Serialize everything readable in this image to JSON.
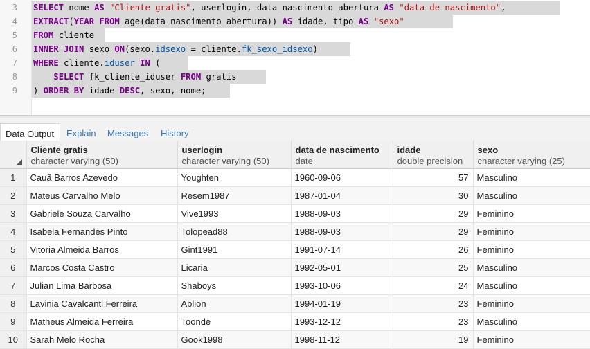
{
  "editor": {
    "line_numbers": [
      "3",
      "4",
      "5",
      "6",
      "7",
      "8",
      "9"
    ]
  },
  "tabs": [
    {
      "label": "Data Output"
    },
    {
      "label": "Explain"
    },
    {
      "label": "Messages"
    },
    {
      "label": "History"
    }
  ],
  "grid": {
    "columns": [
      {
        "name": "Cliente gratis",
        "type": "character varying (50)"
      },
      {
        "name": "userlogin",
        "type": "character varying (50)"
      },
      {
        "name": "data de nascimento",
        "type": "date"
      },
      {
        "name": "idade",
        "type": "double precision"
      },
      {
        "name": "sexo",
        "type": "character varying (25)"
      }
    ],
    "rows": [
      {
        "n": "1",
        "nome": "Cauã Barros Azevedo",
        "login": "Youghten",
        "data": "1960-09-06",
        "idade": "57",
        "sexo": "Masculino"
      },
      {
        "n": "2",
        "nome": "Mateus Carvalho Melo",
        "login": "Resem1987",
        "data": "1987-01-04",
        "idade": "30",
        "sexo": "Masculino"
      },
      {
        "n": "3",
        "nome": "Gabriele Souza Carvalho",
        "login": "Vive1993",
        "data": "1988-09-03",
        "idade": "29",
        "sexo": "Feminino"
      },
      {
        "n": "4",
        "nome": "Isabela Fernandes Pinto",
        "login": "Tolopead88",
        "data": "1988-09-03",
        "idade": "29",
        "sexo": "Feminino"
      },
      {
        "n": "5",
        "nome": "Vitoria Almeida Barros",
        "login": "Gint1991",
        "data": "1991-07-14",
        "idade": "26",
        "sexo": "Feminino"
      },
      {
        "n": "6",
        "nome": "Marcos Costa Castro",
        "login": "Licaria",
        "data": "1992-05-01",
        "idade": "25",
        "sexo": "Masculino"
      },
      {
        "n": "7",
        "nome": "Julian Lima Barbosa",
        "login": "Shaboys",
        "data": "1993-10-06",
        "idade": "24",
        "sexo": "Masculino"
      },
      {
        "n": "8",
        "nome": "Lavinia Cavalcanti Ferreira",
        "login": "Ablion",
        "data": "1994-01-19",
        "idade": "23",
        "sexo": "Feminino"
      },
      {
        "n": "9",
        "nome": "Matheus Almeida Ferreira",
        "login": "Toonde",
        "data": "1993-12-12",
        "idade": "23",
        "sexo": "Masculino"
      },
      {
        "n": "10",
        "nome": "Sarah Melo Rocha",
        "login": "Gook1998",
        "data": "1998-11-12",
        "idade": "19",
        "sexo": "Feminino"
      }
    ]
  },
  "code": {
    "l3": {
      "t1": "SELECT",
      "t2": " nome ",
      "t3": "AS",
      "t4": " ",
      "t5": "\"Cliente gratis\"",
      "t6": ", userlogin, data_nascimento_abertura ",
      "t7": "AS",
      "t8": " ",
      "t9": "\"data de nascimento\"",
      "t10": ","
    },
    "l4": {
      "t1": "EXTRACT",
      "t2": "(",
      "t3": "YEAR",
      "t4": " ",
      "t5": "FROM",
      "t6": " age(data_nascimento_abertura)) ",
      "t7": "AS",
      "t8": " idade, tipo ",
      "t9": "AS",
      "t10": " ",
      "t11": "\"sexo\""
    },
    "l5": {
      "t1": "FROM",
      "t2": " cliente"
    },
    "l6": {
      "t1": "INNER JOIN",
      "t2": " sexo ",
      "t3": "ON",
      "t4": "(sexo.",
      "t5": "idsexo",
      "t6": " = cliente.",
      "t7": "fk_sexo_idsexo",
      "t8": ")"
    },
    "l7": {
      "t1": "WHERE",
      "t2": " cliente.",
      "t3": "iduser",
      "t4": " ",
      "t5": "IN",
      "t6": " ("
    },
    "l8": {
      "t1": "    ",
      "t2": "SELECT",
      "t3": " fk_cliente_iduser ",
      "t4": "FROM",
      "t5": " gratis"
    },
    "l9": {
      "t1": ") ",
      "t2": "ORDER BY",
      "t3": " idade ",
      "t4": "DESC",
      "t5": ", sexo, nome;"
    }
  }
}
